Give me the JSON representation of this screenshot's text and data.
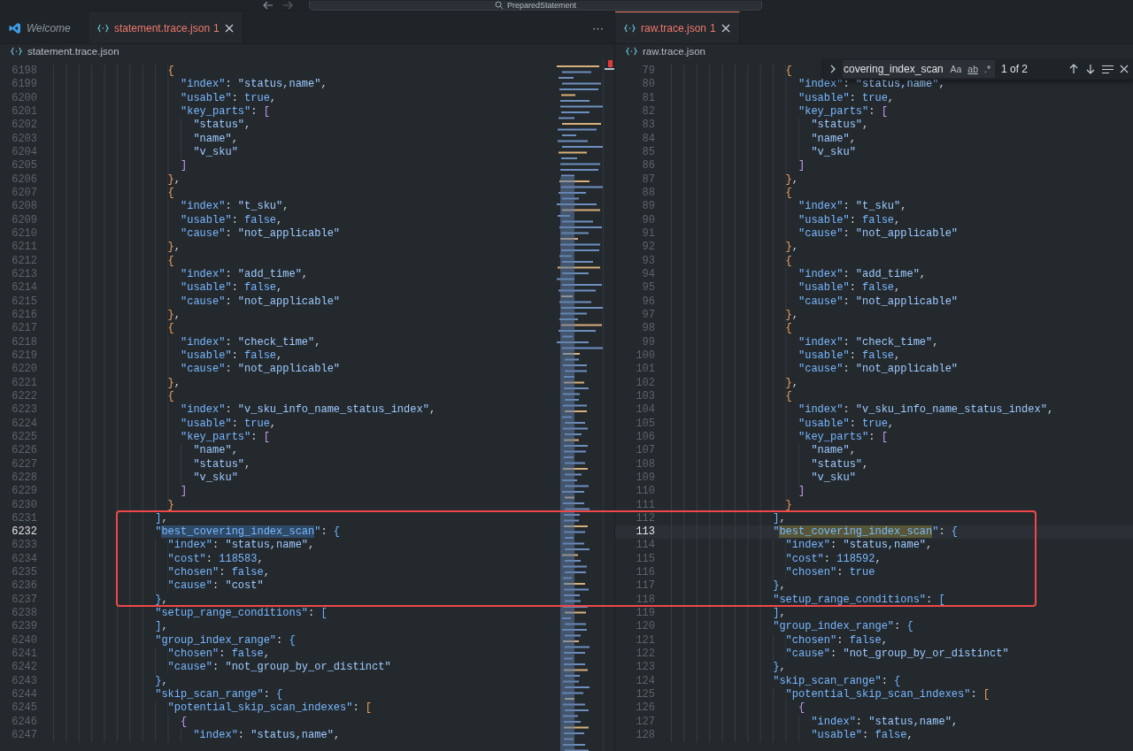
{
  "title_bar": {
    "command_center": "PreparedStatement"
  },
  "panes": [
    {
      "focused": false,
      "tabs": [
        {
          "kind": "welcome",
          "label": "Welcome",
          "preview": true,
          "selected": false
        },
        {
          "kind": "json",
          "label": "statement.trace.json",
          "problems": "1",
          "selected": true
        }
      ],
      "more": "···",
      "breadcrumb": "statement.trace.json",
      "minimap": true,
      "lines": [
        {
          "number": "6198",
          "code": "                  {"
        },
        {
          "number": "6199",
          "code": "                    \"index\": \"status,name\","
        },
        {
          "number": "6200",
          "code": "                    \"usable\": true,"
        },
        {
          "number": "6201",
          "code": "                    \"key_parts\": ["
        },
        {
          "number": "6202",
          "code": "                      \"status\","
        },
        {
          "number": "6203",
          "code": "                      \"name\","
        },
        {
          "number": "6204",
          "code": "                      \"v_sku\""
        },
        {
          "number": "6205",
          "code": "                    ]"
        },
        {
          "number": "6206",
          "code": "                  },"
        },
        {
          "number": "6207",
          "code": "                  {"
        },
        {
          "number": "6208",
          "code": "                    \"index\": \"t_sku\","
        },
        {
          "number": "6209",
          "code": "                    \"usable\": false,"
        },
        {
          "number": "6210",
          "code": "                    \"cause\": \"not_applicable\""
        },
        {
          "number": "6211",
          "code": "                  },"
        },
        {
          "number": "6212",
          "code": "                  {"
        },
        {
          "number": "6213",
          "code": "                    \"index\": \"add_time\","
        },
        {
          "number": "6214",
          "code": "                    \"usable\": false,"
        },
        {
          "number": "6215",
          "code": "                    \"cause\": \"not_applicable\""
        },
        {
          "number": "6216",
          "code": "                  },"
        },
        {
          "number": "6217",
          "code": "                  {"
        },
        {
          "number": "6218",
          "code": "                    \"index\": \"check_time\","
        },
        {
          "number": "6219",
          "code": "                    \"usable\": false,"
        },
        {
          "number": "6220",
          "code": "                    \"cause\": \"not_applicable\""
        },
        {
          "number": "6221",
          "code": "                  },"
        },
        {
          "number": "6222",
          "code": "                  {"
        },
        {
          "number": "6223",
          "code": "                    \"index\": \"v_sku_info_name_status_index\","
        },
        {
          "number": "6224",
          "code": "                    \"usable\": true,"
        },
        {
          "number": "6225",
          "code": "                    \"key_parts\": ["
        },
        {
          "number": "6226",
          "code": "                      \"name\","
        },
        {
          "number": "6227",
          "code": "                      \"status\","
        },
        {
          "number": "6228",
          "code": "                      \"v_sku\""
        },
        {
          "number": "6229",
          "code": "                    ]"
        },
        {
          "number": "6230",
          "code": "                  }"
        },
        {
          "number": "6231",
          "code": "                ],"
        },
        {
          "number": "6232",
          "current": true,
          "kind": "selection",
          "code_parts": [
            "                \"",
            "best_covering_index_scan",
            "\": {"
          ]
        },
        {
          "number": "6233",
          "code": "                  \"index\": \"status,name\","
        },
        {
          "number": "6234",
          "code": "                  \"cost\": 118583,"
        },
        {
          "number": "6235",
          "code": "                  \"chosen\": false,"
        },
        {
          "number": "6236",
          "code": "                  \"cause\": \"cost\""
        },
        {
          "number": "6237",
          "code": "                },"
        },
        {
          "number": "6238",
          "code": "                \"setup_range_conditions\": ["
        },
        {
          "number": "6239",
          "code": "                ],"
        },
        {
          "number": "6240",
          "code": "                \"group_index_range\": {"
        },
        {
          "number": "6241",
          "code": "                  \"chosen\": false,"
        },
        {
          "number": "6242",
          "code": "                  \"cause\": \"not_group_by_or_distinct\""
        },
        {
          "number": "6243",
          "code": "                },"
        },
        {
          "number": "6244",
          "code": "                \"skip_scan_range\": {"
        },
        {
          "number": "6245",
          "code": "                  \"potential_skip_scan_indexes\": ["
        },
        {
          "number": "6246",
          "code": "                    {"
        },
        {
          "number": "6247",
          "code": "                      \"index\": \"status,name\","
        }
      ]
    },
    {
      "focused": true,
      "tabs": [
        {
          "kind": "json",
          "label": "raw.trace.json",
          "problems": "1",
          "selected": true
        }
      ],
      "breadcrumb": "raw.trace.json",
      "minimap": false,
      "find": {
        "value": "covering_index_scan",
        "options": [
          {
            "label": "Aa",
            "selected": false
          },
          {
            "label": "ab",
            "selected": false
          },
          {
            "label": ".*",
            "selected": false
          }
        ],
        "result": "1 of 2"
      },
      "lines": [
        {
          "number": "79",
          "code": "                  {"
        },
        {
          "number": "80",
          "code": "                    \"index\": \"status,name\","
        },
        {
          "number": "81",
          "code": "                    \"usable\": true,"
        },
        {
          "number": "82",
          "code": "                    \"key_parts\": ["
        },
        {
          "number": "83",
          "code": "                      \"status\","
        },
        {
          "number": "84",
          "code": "                      \"name\","
        },
        {
          "number": "85",
          "code": "                      \"v_sku\""
        },
        {
          "number": "86",
          "code": "                    ]"
        },
        {
          "number": "87",
          "code": "                  },"
        },
        {
          "number": "88",
          "code": "                  {"
        },
        {
          "number": "89",
          "code": "                    \"index\": \"t_sku\","
        },
        {
          "number": "90",
          "code": "                    \"usable\": false,"
        },
        {
          "number": "91",
          "code": "                    \"cause\": \"not_applicable\""
        },
        {
          "number": "92",
          "code": "                  },"
        },
        {
          "number": "93",
          "code": "                  {"
        },
        {
          "number": "94",
          "code": "                    \"index\": \"add_time\","
        },
        {
          "number": "95",
          "code": "                    \"usable\": false,"
        },
        {
          "number": "96",
          "code": "                    \"cause\": \"not_applicable\""
        },
        {
          "number": "97",
          "code": "                  },"
        },
        {
          "number": "98",
          "code": "                  {"
        },
        {
          "number": "99",
          "code": "                    \"index\": \"check_time\","
        },
        {
          "number": "100",
          "code": "                    \"usable\": false,"
        },
        {
          "number": "101",
          "code": "                    \"cause\": \"not_applicable\""
        },
        {
          "number": "102",
          "code": "                  },"
        },
        {
          "number": "103",
          "code": "                  {"
        },
        {
          "number": "104",
          "code": "                    \"index\": \"v_sku_info_name_status_index\","
        },
        {
          "number": "105",
          "code": "                    \"usable\": true,"
        },
        {
          "number": "106",
          "code": "                    \"key_parts\": ["
        },
        {
          "number": "107",
          "code": "                      \"name\","
        },
        {
          "number": "108",
          "code": "                      \"status\","
        },
        {
          "number": "109",
          "code": "                      \"v_sku\""
        },
        {
          "number": "110",
          "code": "                    ]"
        },
        {
          "number": "111",
          "code": "                  }"
        },
        {
          "number": "112",
          "code": "                ],"
        },
        {
          "number": "113",
          "current": true,
          "kind": "find_match",
          "code_parts": [
            "                \"",
            "best_covering_index_scan",
            "\": {"
          ]
        },
        {
          "number": "114",
          "code": "                  \"index\": \"status,name\","
        },
        {
          "number": "115",
          "code": "                  \"cost\": 118592,"
        },
        {
          "number": "116",
          "code": "                  \"chosen\": true"
        },
        {
          "number": "117",
          "code": "                },"
        },
        {
          "number": "118",
          "code": "                \"setup_range_conditions\": ["
        },
        {
          "number": "119",
          "code": "                ],"
        },
        {
          "number": "120",
          "code": "                \"group_index_range\": {"
        },
        {
          "number": "121",
          "code": "                  \"chosen\": false,"
        },
        {
          "number": "122",
          "code": "                  \"cause\": \"not_group_by_or_distinct\""
        },
        {
          "number": "123",
          "code": "                },"
        },
        {
          "number": "124",
          "code": "                \"skip_scan_range\": {"
        },
        {
          "number": "125",
          "code": "                  \"potential_skip_scan_indexes\": ["
        },
        {
          "number": "126",
          "code": "                    {"
        },
        {
          "number": "127",
          "code": "                      \"index\": \"status,name\","
        },
        {
          "number": "128",
          "code": "                      \"usable\": false,"
        }
      ]
    }
  ]
}
